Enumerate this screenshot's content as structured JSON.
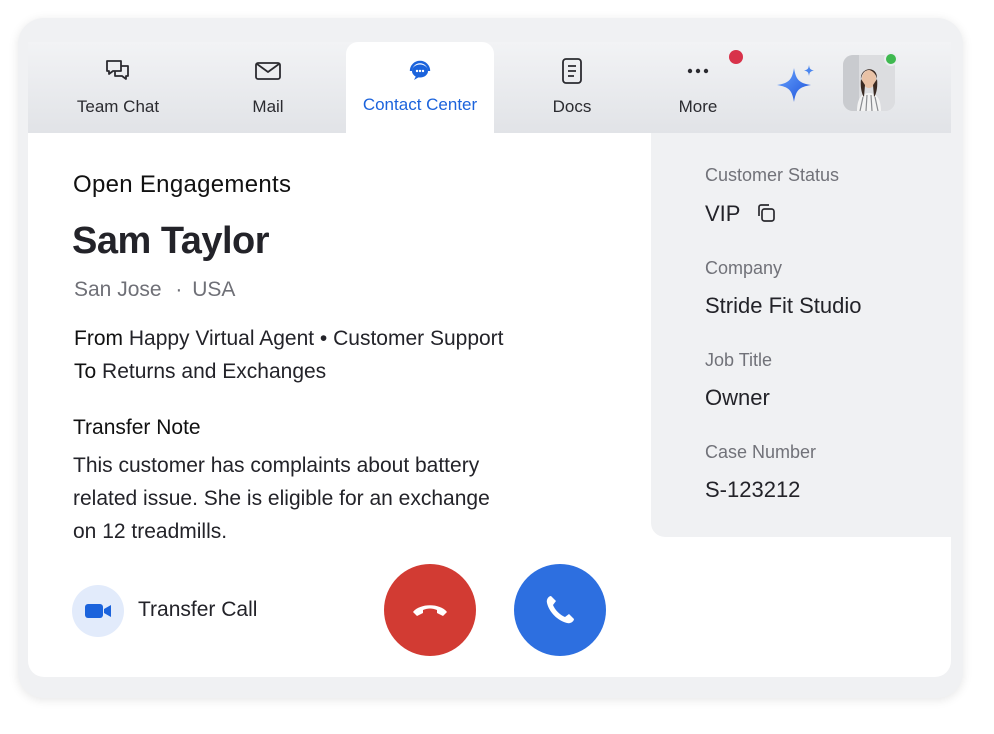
{
  "tabs": [
    {
      "label": "Team Chat",
      "icon": "chat-bubbles-icon"
    },
    {
      "label": "Mail",
      "icon": "envelope-icon"
    },
    {
      "label": "Contact Center",
      "icon": "headset-chat-icon"
    },
    {
      "label": "Docs",
      "icon": "document-icon"
    },
    {
      "label": "More",
      "icon": "more-dots-icon"
    }
  ],
  "active_tab": "Contact Center",
  "colors": {
    "accent": "#1b63dc",
    "decline": "#d23b33",
    "accept": "#2d6fe0",
    "notification": "#d8324a",
    "presence": "#3fb950"
  },
  "engagement": {
    "heading": "Open Engagements",
    "name": "Sam Taylor",
    "city": "San Jose",
    "country": "USA",
    "from_label": "From",
    "from_value": "Happy Virtual Agent • Customer Support",
    "to_label": "To",
    "to_value": "Returns and Exchanges",
    "transfer_note_title": "Transfer Note",
    "transfer_note_body": "This customer has complaints about battery related issue. She is eligible for an exchange on 12 treadmills."
  },
  "actions": {
    "transfer_label": "Transfer Call"
  },
  "customer": {
    "status_label": "Customer Status",
    "status_value": "VIP",
    "company_label": "Company",
    "company_value": "Stride Fit Studio",
    "job_label": "Job Title",
    "job_value": "Owner",
    "case_label": "Case Number",
    "case_value": "S-123212"
  }
}
